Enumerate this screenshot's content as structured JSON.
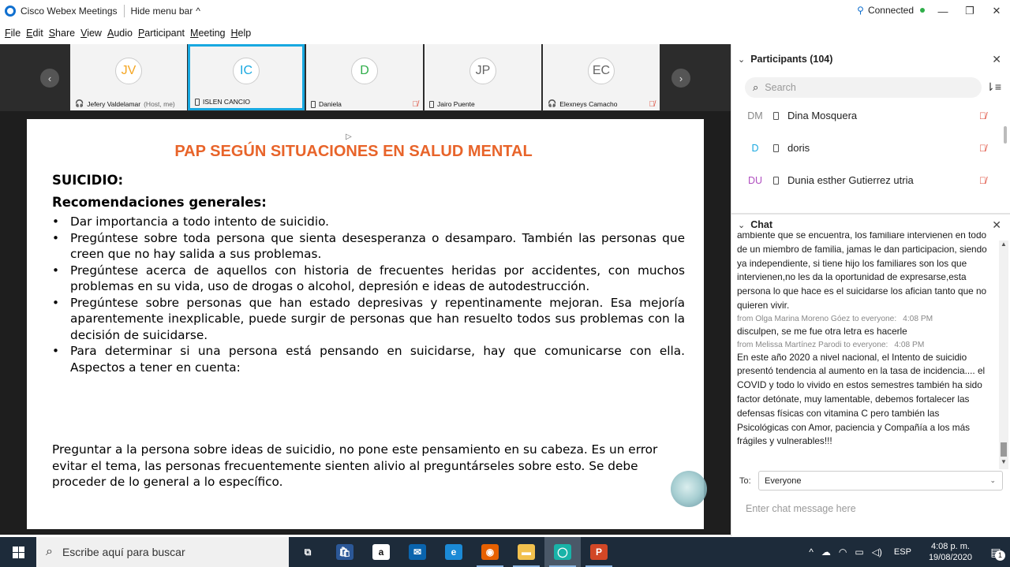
{
  "window": {
    "app_title": "Cisco Webex Meetings",
    "hide_menu_label": "Hide menu bar",
    "hide_menu_chevron": "^",
    "connection_status": "Connected",
    "minimize": "—",
    "restore": "❐",
    "close": "✕"
  },
  "menu": [
    "File",
    "Edit",
    "Share",
    "View",
    "Audio",
    "Participant",
    "Meeting",
    "Help"
  ],
  "filmstrip": {
    "prev": "‹",
    "next": "›",
    "thumbs": [
      {
        "initials": "JV",
        "name": "Jefery Valdelamar",
        "suffix": "(Host, me)",
        "color": "#f5a623"
      },
      {
        "initials": "IC",
        "name": "ISLEN CANCIO",
        "suffix": "",
        "color": "#18a8e0"
      },
      {
        "initials": "D",
        "name": "Daniela",
        "suffix": "",
        "color": "#2fae4a"
      },
      {
        "initials": "JP",
        "name": "Jairo Puente",
        "suffix": "",
        "color": "#666666"
      },
      {
        "initials": "EC",
        "name": "Elexneys Camacho",
        "suffix": "",
        "color": "#666666"
      }
    ]
  },
  "slide": {
    "title": "PAP SEGÚN SITUACIONES EN SALUD MENTAL",
    "heading1": "SUICIDIO:",
    "heading2": "Recomendaciones generales:",
    "bullets": [
      "Dar importancia a todo intento de suicidio.",
      "Pregúntese sobre toda persona que sienta desesperanza o desamparo. También las personas que creen que no hay salida a sus problemas.",
      "Pregúntese acerca de aquellos con historia de frecuentes heridas por accidentes, con muchos problemas en su vida, uso de drogas o alcohol, depresión e ideas de autodestrucción.",
      "Pregúntese sobre personas que han estado depresivas y repentinamente mejoran. Esa mejoría aparentemente inexplicable, puede surgir de personas que han resuelto todos sus problemas con la decisión de suicidarse.",
      "Para determinar si una persona está pensando en suicidarse, hay que comunicarse con ella. Aspectos a tener en cuenta:"
    ],
    "paragraph": "Preguntar a la persona sobre ideas de suicidio, no pone este pensamiento en su cabeza. Es un error evitar el tema, las personas frecuentemente sienten alivio al preguntárseles sobre esto. Se debe proceder de lo general a lo específico."
  },
  "participants": {
    "title": "Participants (104)",
    "search_placeholder": "Search",
    "list": [
      {
        "initials": "DM",
        "name": "Dina Mosquera",
        "color": "#888888"
      },
      {
        "initials": "D",
        "name": "doris",
        "color": "#18a8e0"
      },
      {
        "initials": "DU",
        "name": "Dunia esther Gutierrez utria",
        "color": "#b04fc0"
      }
    ]
  },
  "chat": {
    "title": "Chat",
    "messages": [
      {
        "type": "msg",
        "text": "ambiente que se encuentra, los familiare intervienen en todo de un miembro de familia, jamas le dan participacion, siendo ya independiente, si tiene hijo los familiares son los que intervienen,no les da la oportunidad de expresarse,esta persona lo que hace es el suicidarse los afician tanto que no quieren vivir."
      },
      {
        "type": "from",
        "text": "from Olga Marina Moreno Góez to everyone:",
        "time": "4:08 PM"
      },
      {
        "type": "msg",
        "text": "disculpen, se me fue otra letra es  hacerle"
      },
      {
        "type": "from",
        "text": "from Melissa Martínez Parodi to everyone:",
        "time": "4:08 PM"
      },
      {
        "type": "msg",
        "text": "En este año 2020 a nivel nacional, el Intento de suicidio presentó tendencia al aumento en la tasa de incidencia.... el COVID y todo lo vivido en estos semestres también ha sido factor detónate, muy lamentable, debemos fortalecer las defensas físicas con vitamina C pero también las Psicológicas con Amor, paciencia y Compañía a los más frágiles y vulnerables!!!"
      }
    ],
    "to_label": "To:",
    "to_value": "Everyone",
    "input_placeholder": "Enter chat message here"
  },
  "taskbar": {
    "search_placeholder": "Escribe aquí para buscar",
    "apps": [
      {
        "name": "task-view",
        "glyph": "⧉",
        "bg": "transparent"
      },
      {
        "name": "store",
        "glyph": "🛍",
        "bg": "#2b5797"
      },
      {
        "name": "amazon",
        "glyph": "a",
        "bg": "#ffffff"
      },
      {
        "name": "mail",
        "glyph": "✉",
        "bg": "#0a64ad"
      },
      {
        "name": "edge",
        "glyph": "e",
        "bg": "#1b8ad6"
      },
      {
        "name": "firefox",
        "glyph": "◉",
        "bg": "#e66000"
      },
      {
        "name": "explorer",
        "glyph": "▬",
        "bg": "#f2c14e"
      },
      {
        "name": "webex",
        "glyph": "◯",
        "bg": "#19b3a8"
      },
      {
        "name": "powerpoint",
        "glyph": "P",
        "bg": "#d24726"
      }
    ],
    "lang": "ESP",
    "time": "4:08 p. m.",
    "date": "19/08/2020",
    "notifications": "1"
  }
}
